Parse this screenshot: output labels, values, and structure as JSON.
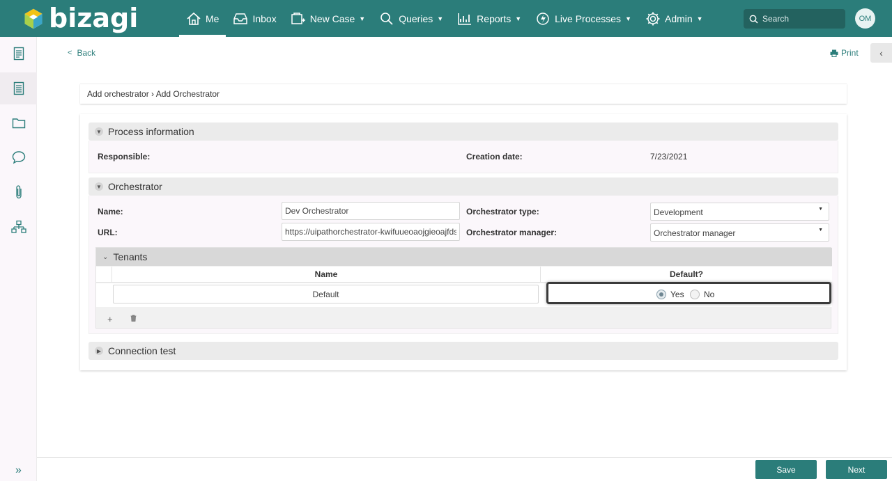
{
  "brand": {
    "name": "bizagi",
    "accent": "#2b7d7a"
  },
  "nav": {
    "me": "Me",
    "inbox": "Inbox",
    "new_case": "New Case",
    "queries": "Queries",
    "reports": "Reports",
    "live_processes": "Live Processes",
    "admin": "Admin"
  },
  "search": {
    "placeholder": "Search"
  },
  "user": {
    "initials": "OM"
  },
  "rail": [
    "work-icon",
    "cases-icon",
    "folder-icon",
    "chat-icon",
    "attachment-icon",
    "process-map-icon"
  ],
  "page": {
    "back_label": "Back",
    "print_label": "Print",
    "breadcrumb": "Add orchestrator › Add Orchestrator"
  },
  "process_info": {
    "title": "Process information",
    "responsible_label": "Responsible:",
    "responsible_value": "",
    "creation_date_label": "Creation date:",
    "creation_date_value": "7/23/2021"
  },
  "orchestrator": {
    "title": "Orchestrator",
    "name_label": "Name:",
    "name_value": "Dev Orchestrator",
    "url_label": "URL:",
    "url_value": "https://uipathorchestrator-kwifuueoaojgieoajfdsija",
    "type_label": "Orchestrator type:",
    "type_value": "Development",
    "manager_label": "Orchestrator manager:",
    "manager_value": "Orchestrator manager"
  },
  "tenants": {
    "title": "Tenants",
    "col_name": "Name",
    "col_default": "Default?",
    "rows": [
      {
        "name": "Default",
        "default": "Yes"
      }
    ],
    "yes_label": "Yes",
    "no_label": "No",
    "add_symbol": "+",
    "delete_symbol": "🗑"
  },
  "connection_test": {
    "title": "Connection test"
  },
  "footer": {
    "save_label": "Save",
    "next_label": "Next"
  }
}
